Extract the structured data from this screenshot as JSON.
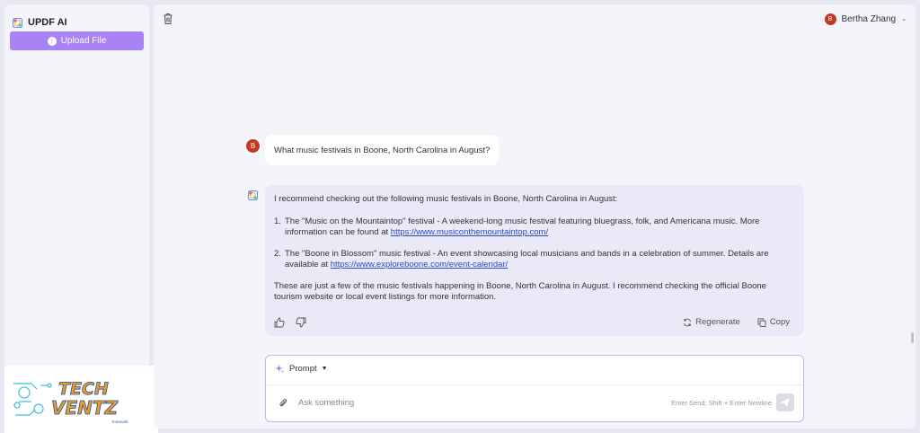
{
  "sidebar": {
    "brand": "UPDF AI",
    "upload_label": "Upload File"
  },
  "header": {
    "user_initial": "B",
    "user_name": "Bertha Zhang"
  },
  "chat": {
    "question": {
      "avatar": "B",
      "text": "What music festivals in Boone, North Carolina in August?"
    },
    "answer": {
      "intro": "I recommend checking out the following music festivals in Boone, North Carolina in August:",
      "items": [
        {
          "num": "1.",
          "text": "The \"Music on the Mountaintop\" festival - A weekend-long music festival featuring bluegrass, folk, and Americana music. More information can be found at ",
          "link": "https://www.musiconthemountaintop.com/"
        },
        {
          "num": "2.",
          "text": "The \"Boone in Blossom\" music festival - An event showcasing local musicians and bands in a celebration of summer. Details are available at ",
          "link": "https://www.exploreboone.com/event-calendar/"
        }
      ],
      "outro": "These are just a few of the music festivals happening in Boone, North Carolina in August. I recommend checking the official Boone tourism website or local event listings for more information.",
      "regenerate_label": "Regenerate",
      "copy_label": "Copy"
    }
  },
  "prompt": {
    "label": "Prompt",
    "placeholder": "Ask something",
    "hint": "Enter Send; Shift + Enter Newline"
  },
  "watermark": {
    "line1": "TECH",
    "line2": "VENTZ",
    "tagline": "Innovate"
  },
  "colors": {
    "accent": "#a783f4",
    "avatar": "#c2391f",
    "answer_bg": "#ebe9f8",
    "link": "#2a4cc7"
  }
}
